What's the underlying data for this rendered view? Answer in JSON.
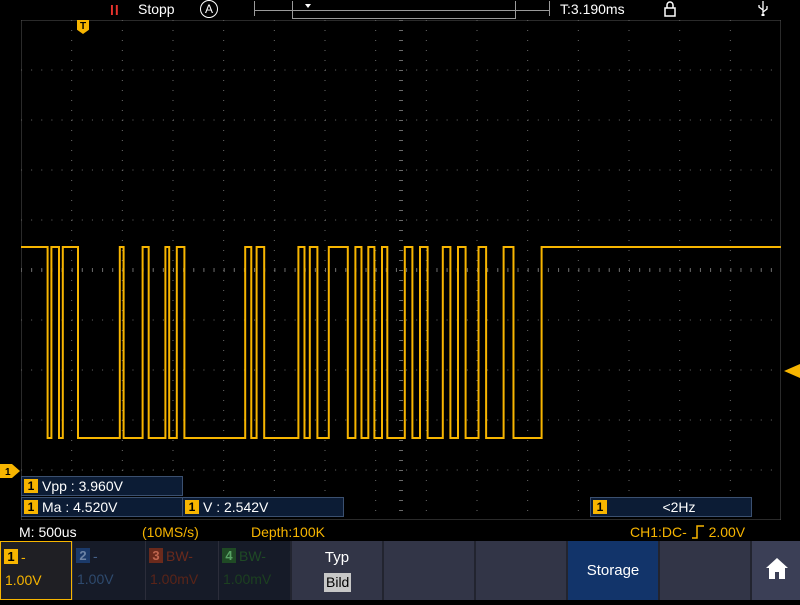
{
  "top_bar": {
    "run_icon": "pause-icon",
    "run_status": "Stopp",
    "trigger_mode_icon": "A",
    "time_offset": "T:3.190ms",
    "lock_icon": "lock-icon",
    "usb_icon": "usb-icon"
  },
  "colors": {
    "ch1": "#f7b500",
    "ch2": "#1b3a6a",
    "ch3": "#b33a22",
    "ch4": "#2a8a3a",
    "grid": "#6a6a6a",
    "stopped": "#e8332d"
  },
  "markers": {
    "trigger_position": "T",
    "ch1_ground": "1"
  },
  "measurements": {
    "vpp": {
      "channel": "1",
      "text": "Vpp : 3.960V"
    },
    "max": {
      "channel": "1",
      "text": "Ma : 4.520V"
    },
    "avg": {
      "channel": "1",
      "text": "V : 2.542V"
    },
    "freq": {
      "channel": "1",
      "text": "<2Hz"
    }
  },
  "status_line": {
    "timebase": "M: 500us",
    "sample_rate": "(10MS/s)",
    "depth": "Depth:100K",
    "trigger": "CH1:DC-",
    "trigger_level": "2.00V"
  },
  "channels": [
    {
      "tag": "1",
      "name": "-",
      "scale": "1.00V"
    },
    {
      "tag": "2",
      "name": "-",
      "scale": "1.00V"
    },
    {
      "tag": "3",
      "name": "BW-",
      "scale": "1.00mV"
    },
    {
      "tag": "4",
      "name": "BW-",
      "scale": "1.00mV"
    }
  ],
  "menu": {
    "type_label": "Typ",
    "type_value": "Bild",
    "storage_label": "Storage",
    "home_icon": "home-icon"
  },
  "waveform": {
    "channel": "1",
    "description_levels": [
      "high",
      "low"
    ],
    "transitions_ms_note": "serial pulse train",
    "edges": [
      [
        0.0,
        1
      ],
      [
        0.35,
        0
      ],
      [
        0.4,
        1
      ],
      [
        0.5,
        0
      ],
      [
        0.55,
        1
      ],
      [
        0.75,
        0
      ],
      [
        1.3,
        1
      ],
      [
        1.35,
        0
      ],
      [
        1.6,
        1
      ],
      [
        1.68,
        0
      ],
      [
        1.9,
        1
      ],
      [
        1.95,
        0
      ],
      [
        2.05,
        1
      ],
      [
        2.15,
        0
      ],
      [
        2.95,
        1
      ],
      [
        3.03,
        0
      ],
      [
        3.1,
        1
      ],
      [
        3.2,
        0
      ],
      [
        3.65,
        1
      ],
      [
        3.73,
        0
      ],
      [
        3.8,
        1
      ],
      [
        3.9,
        0
      ],
      [
        4.05,
        1
      ],
      [
        4.3,
        0
      ],
      [
        4.4,
        1
      ],
      [
        4.48,
        0
      ],
      [
        4.57,
        1
      ],
      [
        4.65,
        0
      ],
      [
        4.75,
        1
      ],
      [
        4.82,
        0
      ],
      [
        5.05,
        1
      ],
      [
        5.15,
        0
      ],
      [
        5.25,
        1
      ],
      [
        5.35,
        0
      ],
      [
        5.55,
        1
      ],
      [
        5.65,
        0
      ],
      [
        5.75,
        1
      ],
      [
        5.85,
        0
      ],
      [
        6.02,
        1
      ],
      [
        6.12,
        0
      ],
      [
        6.35,
        1
      ],
      [
        6.48,
        0
      ],
      [
        6.85,
        1
      ],
      [
        10.0,
        1
      ]
    ]
  }
}
